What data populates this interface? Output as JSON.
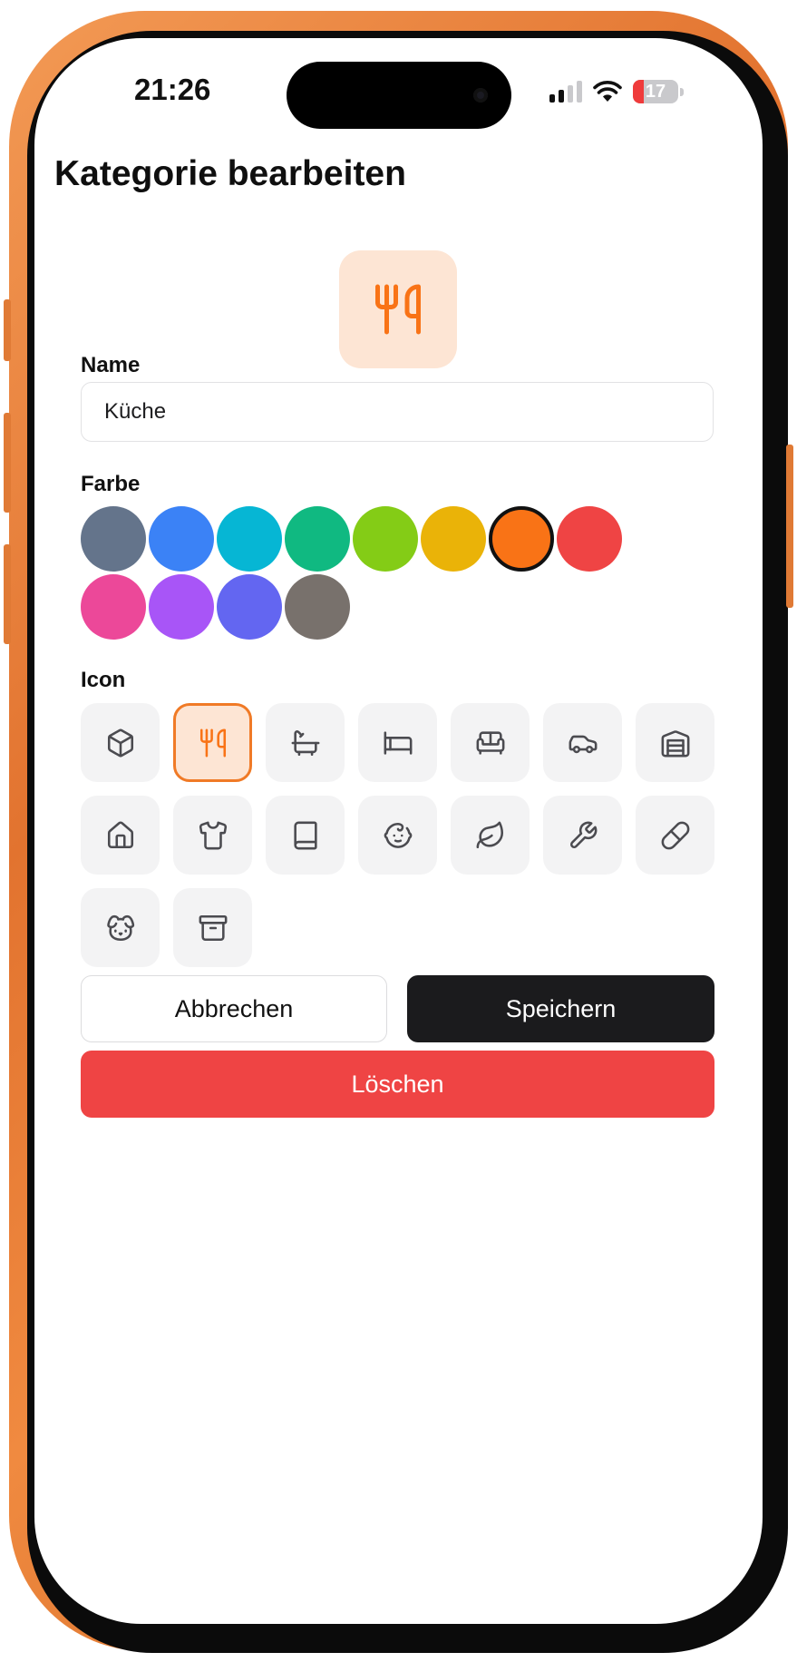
{
  "status_bar": {
    "time": "21:26",
    "battery": "17"
  },
  "page": {
    "title": "Kategorie bearbeiten"
  },
  "preview": {
    "icon": "utensils-icon",
    "color": "#f97316",
    "background": "#fde5d4"
  },
  "name_field": {
    "label": "Name",
    "value": "Küche"
  },
  "color_section": {
    "label": "Farbe",
    "selected": "#f97316",
    "colors": [
      "#64748b",
      "#3b82f6",
      "#06b6d4",
      "#10b981",
      "#84cc16",
      "#eab308",
      "#f97316",
      "#ef4444",
      "#ec4899",
      "#a855f7",
      "#6366f1",
      "#78716c"
    ]
  },
  "icon_section": {
    "label": "Icon",
    "selected": "utensils-icon",
    "icons": [
      "box-icon",
      "utensils-icon",
      "bath-icon",
      "bed-icon",
      "sofa-icon",
      "car-icon",
      "warehouse-icon",
      "home-icon",
      "shirt-icon",
      "book-icon",
      "baby-icon",
      "leaf-icon",
      "wrench-icon",
      "pill-icon",
      "dog-icon",
      "archive-icon"
    ]
  },
  "actions": {
    "cancel": "Abbrechen",
    "save": "Speichern",
    "delete": "Löschen"
  }
}
